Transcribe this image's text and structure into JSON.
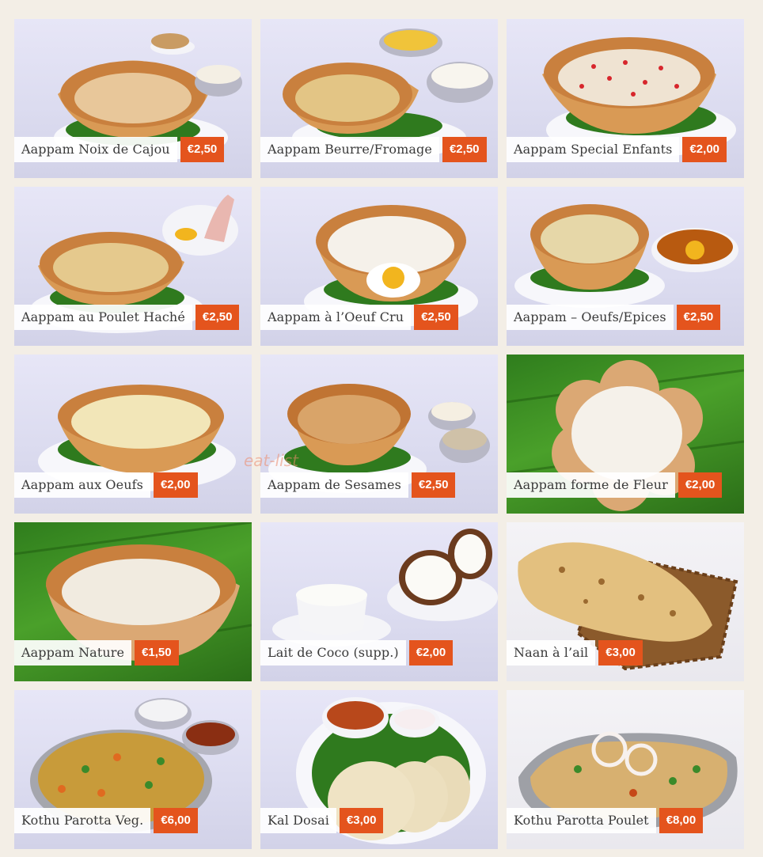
{
  "menu": {
    "items": [
      {
        "name": "Aappam Noix de Cajou",
        "price": "€2,50",
        "icon": "appam-cashew-icon"
      },
      {
        "name": "Aappam Beurre/Fromage",
        "price": "€2,50",
        "icon": "appam-butter-cheese-icon"
      },
      {
        "name": "Aappam Special Enfants",
        "price": "€2,00",
        "icon": "appam-kids-icon"
      },
      {
        "name": "Aappam au Poulet Haché",
        "price": "€2,50",
        "icon": "appam-chicken-icon"
      },
      {
        "name": "Aappam à l’Oeuf Cru",
        "price": "€2,50",
        "icon": "appam-raw-egg-icon"
      },
      {
        "name": "Aappam – Oeufs/Epices",
        "price": "€2,50",
        "icon": "appam-egg-spice-icon"
      },
      {
        "name": "Aappam aux Oeufs",
        "price": "€2,00",
        "icon": "appam-egg-icon"
      },
      {
        "name": "Aappam de Sesames",
        "price": "€2,50",
        "icon": "appam-sesame-icon"
      },
      {
        "name": "Aappam forme de Fleur",
        "price": "€2,00",
        "icon": "appam-flower-icon"
      },
      {
        "name": "Aappam Nature",
        "price": "€1,50",
        "icon": "appam-plain-icon"
      },
      {
        "name": "Lait de Coco (supp.)",
        "price": "€2,00",
        "icon": "coconut-milk-icon"
      },
      {
        "name": "Naan à l’ail",
        "price": "€3,00",
        "icon": "garlic-naan-icon"
      },
      {
        "name": "Kothu Parotta Veg.",
        "price": "€6,00",
        "icon": "kothu-parotta-veg-icon"
      },
      {
        "name": "Kal Dosai",
        "price": "€3,00",
        "icon": "kal-dosai-icon"
      },
      {
        "name": "Kothu Parotta Poulet",
        "price": "€8,00",
        "icon": "kothu-parotta-chicken-icon"
      }
    ]
  },
  "watermark": "eat-list",
  "colors": {
    "price_badge": "#e4541d",
    "label_bg": "#ffffff",
    "page_bg": "#f3eee6"
  }
}
